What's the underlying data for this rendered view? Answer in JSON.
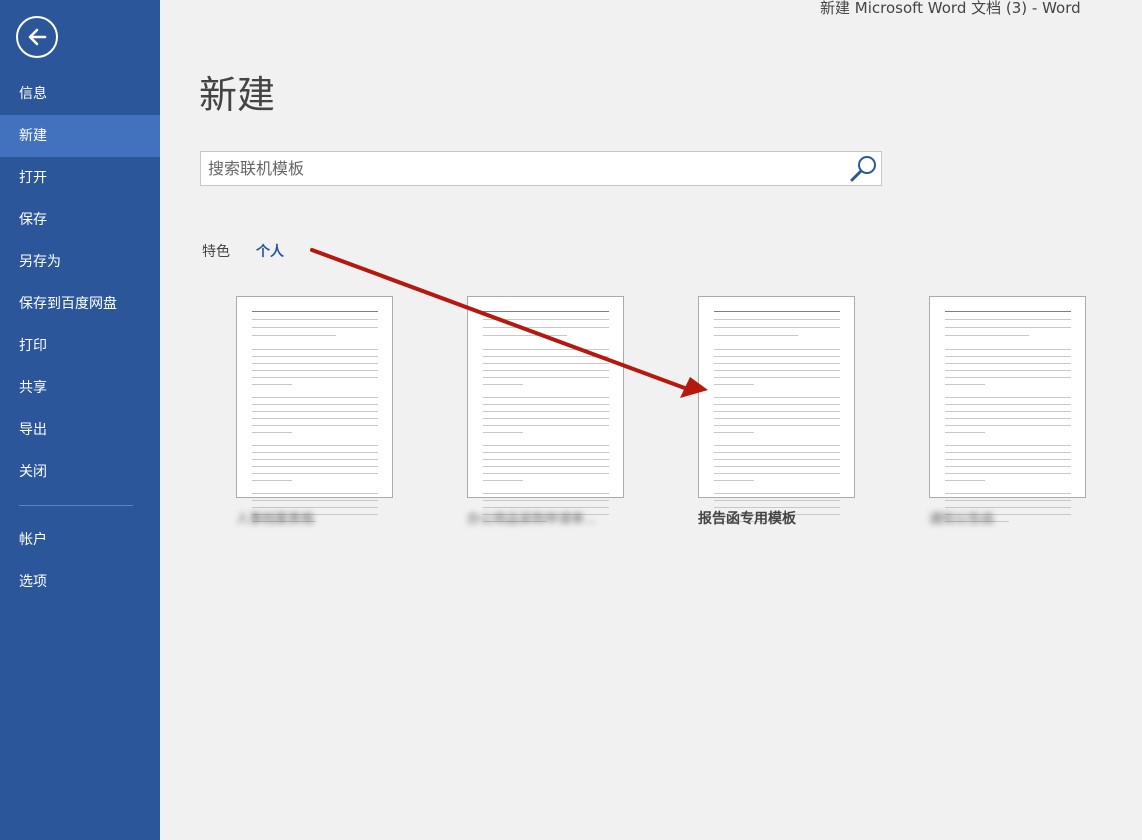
{
  "window": {
    "title": "新建 Microsoft Word 文档 (3) - Word"
  },
  "sidebar": {
    "back_icon": "back-arrow-icon",
    "items": [
      {
        "label": "信息"
      },
      {
        "label": "新建"
      },
      {
        "label": "打开"
      },
      {
        "label": "保存"
      },
      {
        "label": "另存为"
      },
      {
        "label": "保存到百度网盘"
      },
      {
        "label": "打印"
      },
      {
        "label": "共享"
      },
      {
        "label": "导出"
      },
      {
        "label": "关闭"
      }
    ],
    "bottom_items": [
      {
        "label": "帐户"
      },
      {
        "label": "选项"
      }
    ],
    "active": "新建",
    "bg_color": "#2b579a",
    "active_color": "#4272bd"
  },
  "main": {
    "title": "新建",
    "search": {
      "placeholder": "搜索联机模板",
      "value": "",
      "icon": "search-icon"
    },
    "tabs": [
      {
        "label": "特色"
      },
      {
        "label": "个人"
      }
    ],
    "active_tab": "个人",
    "templates": [
      {
        "label": "人事档案表格"
      },
      {
        "label": "办公用品采购申请单..."
      },
      {
        "label": "报告函专用模板"
      },
      {
        "label": "通知公告函"
      }
    ]
  },
  "annotation": {
    "arrow_color": "#b5180d"
  }
}
